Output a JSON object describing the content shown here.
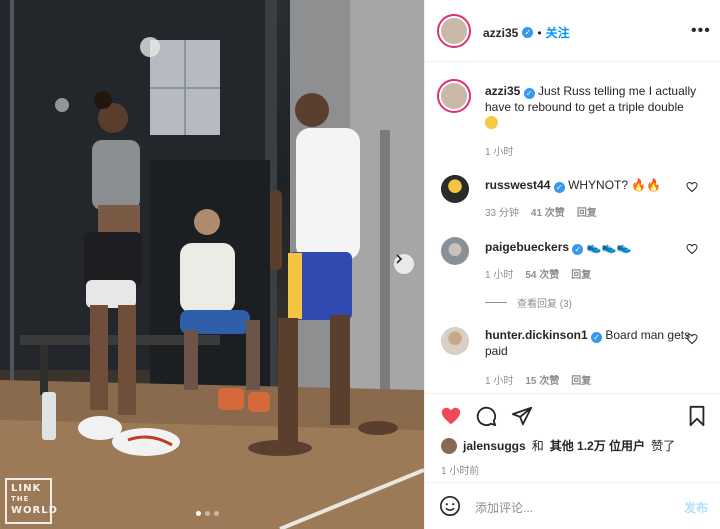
{
  "post": {
    "author": "azzi35",
    "follow_label": "关注",
    "more_label": "•••"
  },
  "caption": {
    "username": "azzi35",
    "text": "Just Russ telling me I actually have to rebound to get a triple double",
    "emoji": "smiling-face",
    "time": "1 小时"
  },
  "comments": [
    {
      "username": "russwest44",
      "verified": true,
      "text": "WHYNOT?",
      "emoji": "fire-x2",
      "time": "33 分钟",
      "likes": "41 次赞",
      "reply": "回复",
      "avatar_color": "#2b2b2b"
    },
    {
      "username": "paigebueckers",
      "verified": true,
      "text": "",
      "emoji": "running-shoe-x3",
      "time": "1 小时",
      "likes": "54 次赞",
      "reply": "回复",
      "avatar_color": "#8a9096",
      "view_replies": "查看回复 (3)"
    },
    {
      "username": "hunter.dickinson1",
      "verified": true,
      "text": "Board man gets paid",
      "emoji": "",
      "time": "1 小时",
      "likes": "15 次赞",
      "reply": "回复",
      "avatar_color": "#b59c86"
    }
  ],
  "actions": {
    "liked": true,
    "like_color": "#ed4956",
    "liked_by_user": "jalensuggs",
    "liked_by_conj": "和",
    "liked_by_others": "其他 1.2万 位用户",
    "liked_by_suffix": "赞了",
    "time": "1 小时前"
  },
  "add_comment": {
    "placeholder": "添加评论...",
    "post_label": "发布"
  },
  "media": {
    "watermark": [
      "LINK",
      "THE",
      "WORLD"
    ],
    "slide_count": 3,
    "active_slide": 1
  }
}
